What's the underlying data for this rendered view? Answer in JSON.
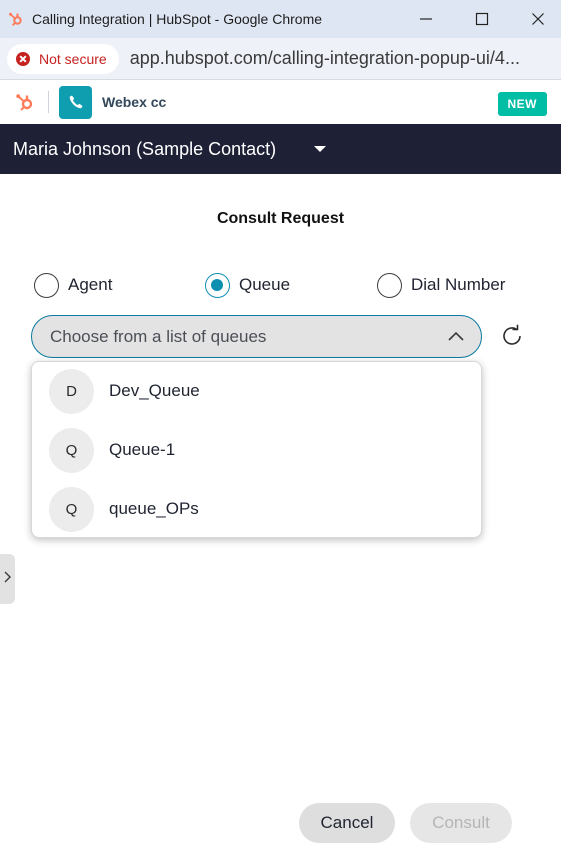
{
  "browser": {
    "window_title": "Calling Integration | HubSpot - Google Chrome",
    "security_label": "Not secure",
    "url": "app.hubspot.com/calling-integration-popup-ui/4..."
  },
  "integration": {
    "name": "Webex cc",
    "badge": "NEW"
  },
  "contact": {
    "name": "Maria Johnson (Sample Contact)"
  },
  "consult": {
    "heading": "Consult Request",
    "options": [
      {
        "label": "Agent",
        "selected": false
      },
      {
        "label": "Queue",
        "selected": true
      },
      {
        "label": "Dial Number",
        "selected": false
      }
    ],
    "select_placeholder": "Choose from a list of queues",
    "queues": [
      {
        "initial": "D",
        "label": "Dev_Queue"
      },
      {
        "initial": "Q",
        "label": "Queue-1"
      },
      {
        "initial": "Q",
        "label": "queue_OPs"
      }
    ],
    "cancel_label": "Cancel",
    "consult_label": "Consult"
  },
  "colors": {
    "accent": "#0f8fb0",
    "header_dark": "#1e2036",
    "badge": "#00bda5",
    "hubspot_orange": "#ff7a59",
    "danger": "#c5221f"
  },
  "icons": [
    "hubspot-logo-icon",
    "minimize-icon",
    "maximize-icon",
    "close-icon",
    "not-secure-icon",
    "phone-icon",
    "caret-down-icon",
    "chevron-up-icon",
    "refresh-icon",
    "chevron-right-icon"
  ]
}
